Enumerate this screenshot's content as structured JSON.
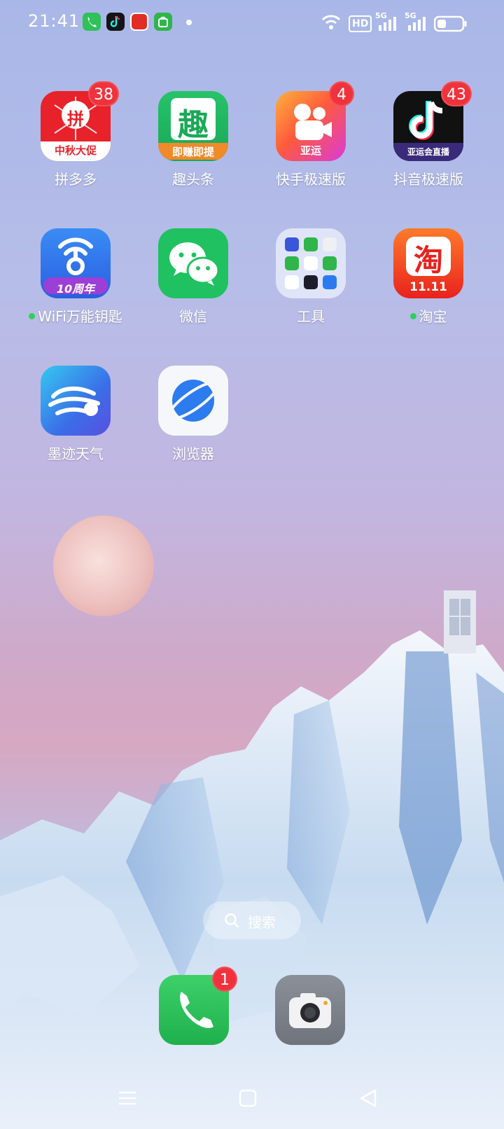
{
  "status_bar": {
    "time": "21:41",
    "indicators": [
      "HD",
      "5G",
      "5G"
    ],
    "notification_icons": [
      "phone-icon",
      "douyin-icon",
      "pinduoduo-icon",
      "app-store-icon"
    ]
  },
  "apps": [
    {
      "name": "拼多多",
      "badge": "38",
      "icon": "pinduoduo-icon",
      "icon_text": "拼",
      "icon_sub": "中秋大促"
    },
    {
      "name": "趣头条",
      "badge": "",
      "icon": "qutoutiao-icon",
      "icon_text": "趣",
      "icon_sub": "即赚即提"
    },
    {
      "name": "快手极速版",
      "badge": "4",
      "icon": "kuaishou-icon",
      "icon_text": "",
      "icon_sub": "亚运"
    },
    {
      "name": "抖音极速版",
      "badge": "43",
      "icon": "douyin-icon",
      "icon_text": "",
      "icon_sub": "亚运会直播"
    },
    {
      "name": "WiFi万能钥匙",
      "badge": "",
      "icon": "wifi-key-icon",
      "icon_text": "",
      "icon_sub": "10周年",
      "dot": true
    },
    {
      "name": "微信",
      "badge": "",
      "icon": "wechat-icon",
      "icon_text": "",
      "icon_sub": ""
    },
    {
      "name": "工具",
      "badge": "",
      "icon": "tools-folder-icon",
      "icon_text": "",
      "icon_sub": ""
    },
    {
      "name": "淘宝",
      "badge": "",
      "icon": "taobao-icon",
      "icon_text": "淘",
      "icon_sub": "11.11",
      "dot": true
    },
    {
      "name": "墨迹天气",
      "badge": "",
      "icon": "moji-weather-icon",
      "icon_text": "",
      "icon_sub": ""
    },
    {
      "name": "浏览器",
      "badge": "",
      "icon": "browser-icon",
      "icon_text": "",
      "icon_sub": ""
    }
  ],
  "search": {
    "label": "搜索"
  },
  "dock": [
    {
      "name": "phone",
      "badge": "1",
      "icon": "phone-icon"
    },
    {
      "name": "camera",
      "badge": "",
      "icon": "camera-icon"
    }
  ],
  "nav": [
    "menu-icon",
    "home-icon",
    "back-icon"
  ]
}
